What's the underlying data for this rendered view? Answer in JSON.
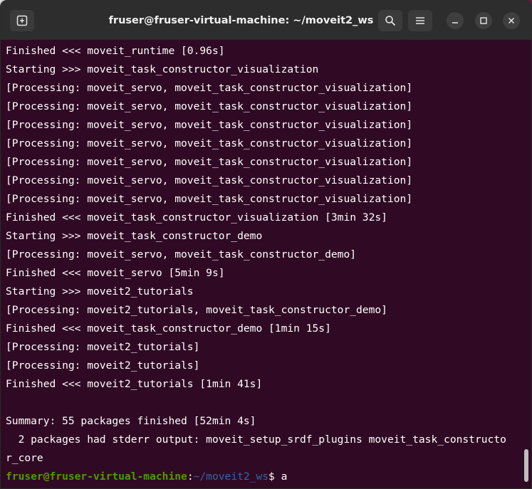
{
  "window": {
    "title": "fruser@fruser-virtual-machine: ~/moveit2_ws"
  },
  "icons": {
    "new_tab": "new-tab-icon",
    "search": "search-icon",
    "menu": "hamburger-menu-icon",
    "minimize": "minimize-icon",
    "maximize": "maximize-icon",
    "close": "close-icon"
  },
  "terminal": {
    "lines": [
      "Finished <<< moveit_runtime [0.96s]",
      "Starting >>> moveit_task_constructor_visualization",
      "[Processing: moveit_servo, moveit_task_constructor_visualization]",
      "[Processing: moveit_servo, moveit_task_constructor_visualization]",
      "[Processing: moveit_servo, moveit_task_constructor_visualization]",
      "[Processing: moveit_servo, moveit_task_constructor_visualization]",
      "[Processing: moveit_servo, moveit_task_constructor_visualization]",
      "[Processing: moveit_servo, moveit_task_constructor_visualization]",
      "[Processing: moveit_servo, moveit_task_constructor_visualization]",
      "Finished <<< moveit_task_constructor_visualization [3min 32s]",
      "Starting >>> moveit_task_constructor_demo",
      "[Processing: moveit_servo, moveit_task_constructor_demo]",
      "Finished <<< moveit_servo [5min 9s]",
      "Starting >>> moveit2_tutorials",
      "[Processing: moveit2_tutorials, moveit_task_constructor_demo]",
      "Finished <<< moveit_task_constructor_demo [1min 15s]",
      "[Processing: moveit2_tutorials]",
      "[Processing: moveit2_tutorials]",
      "Finished <<< moveit2_tutorials [1min 41s]",
      "",
      "Summary: 55 packages finished [52min 4s]",
      "  2 packages had stderr output: moveit_setup_srdf_plugins moveit_task_constructo",
      "r_core"
    ],
    "prompt": {
      "user_host": "fruser@fruser-virtual-machine",
      "separator": ":",
      "path": "~/moveit2_ws",
      "symbol": "$ ",
      "input": "a"
    }
  },
  "colors": {
    "terminal_bg": "#300a24",
    "titlebar_bg": "#2d2d2d",
    "prompt_user": "#4e9a06",
    "prompt_path": "#3465a4"
  }
}
